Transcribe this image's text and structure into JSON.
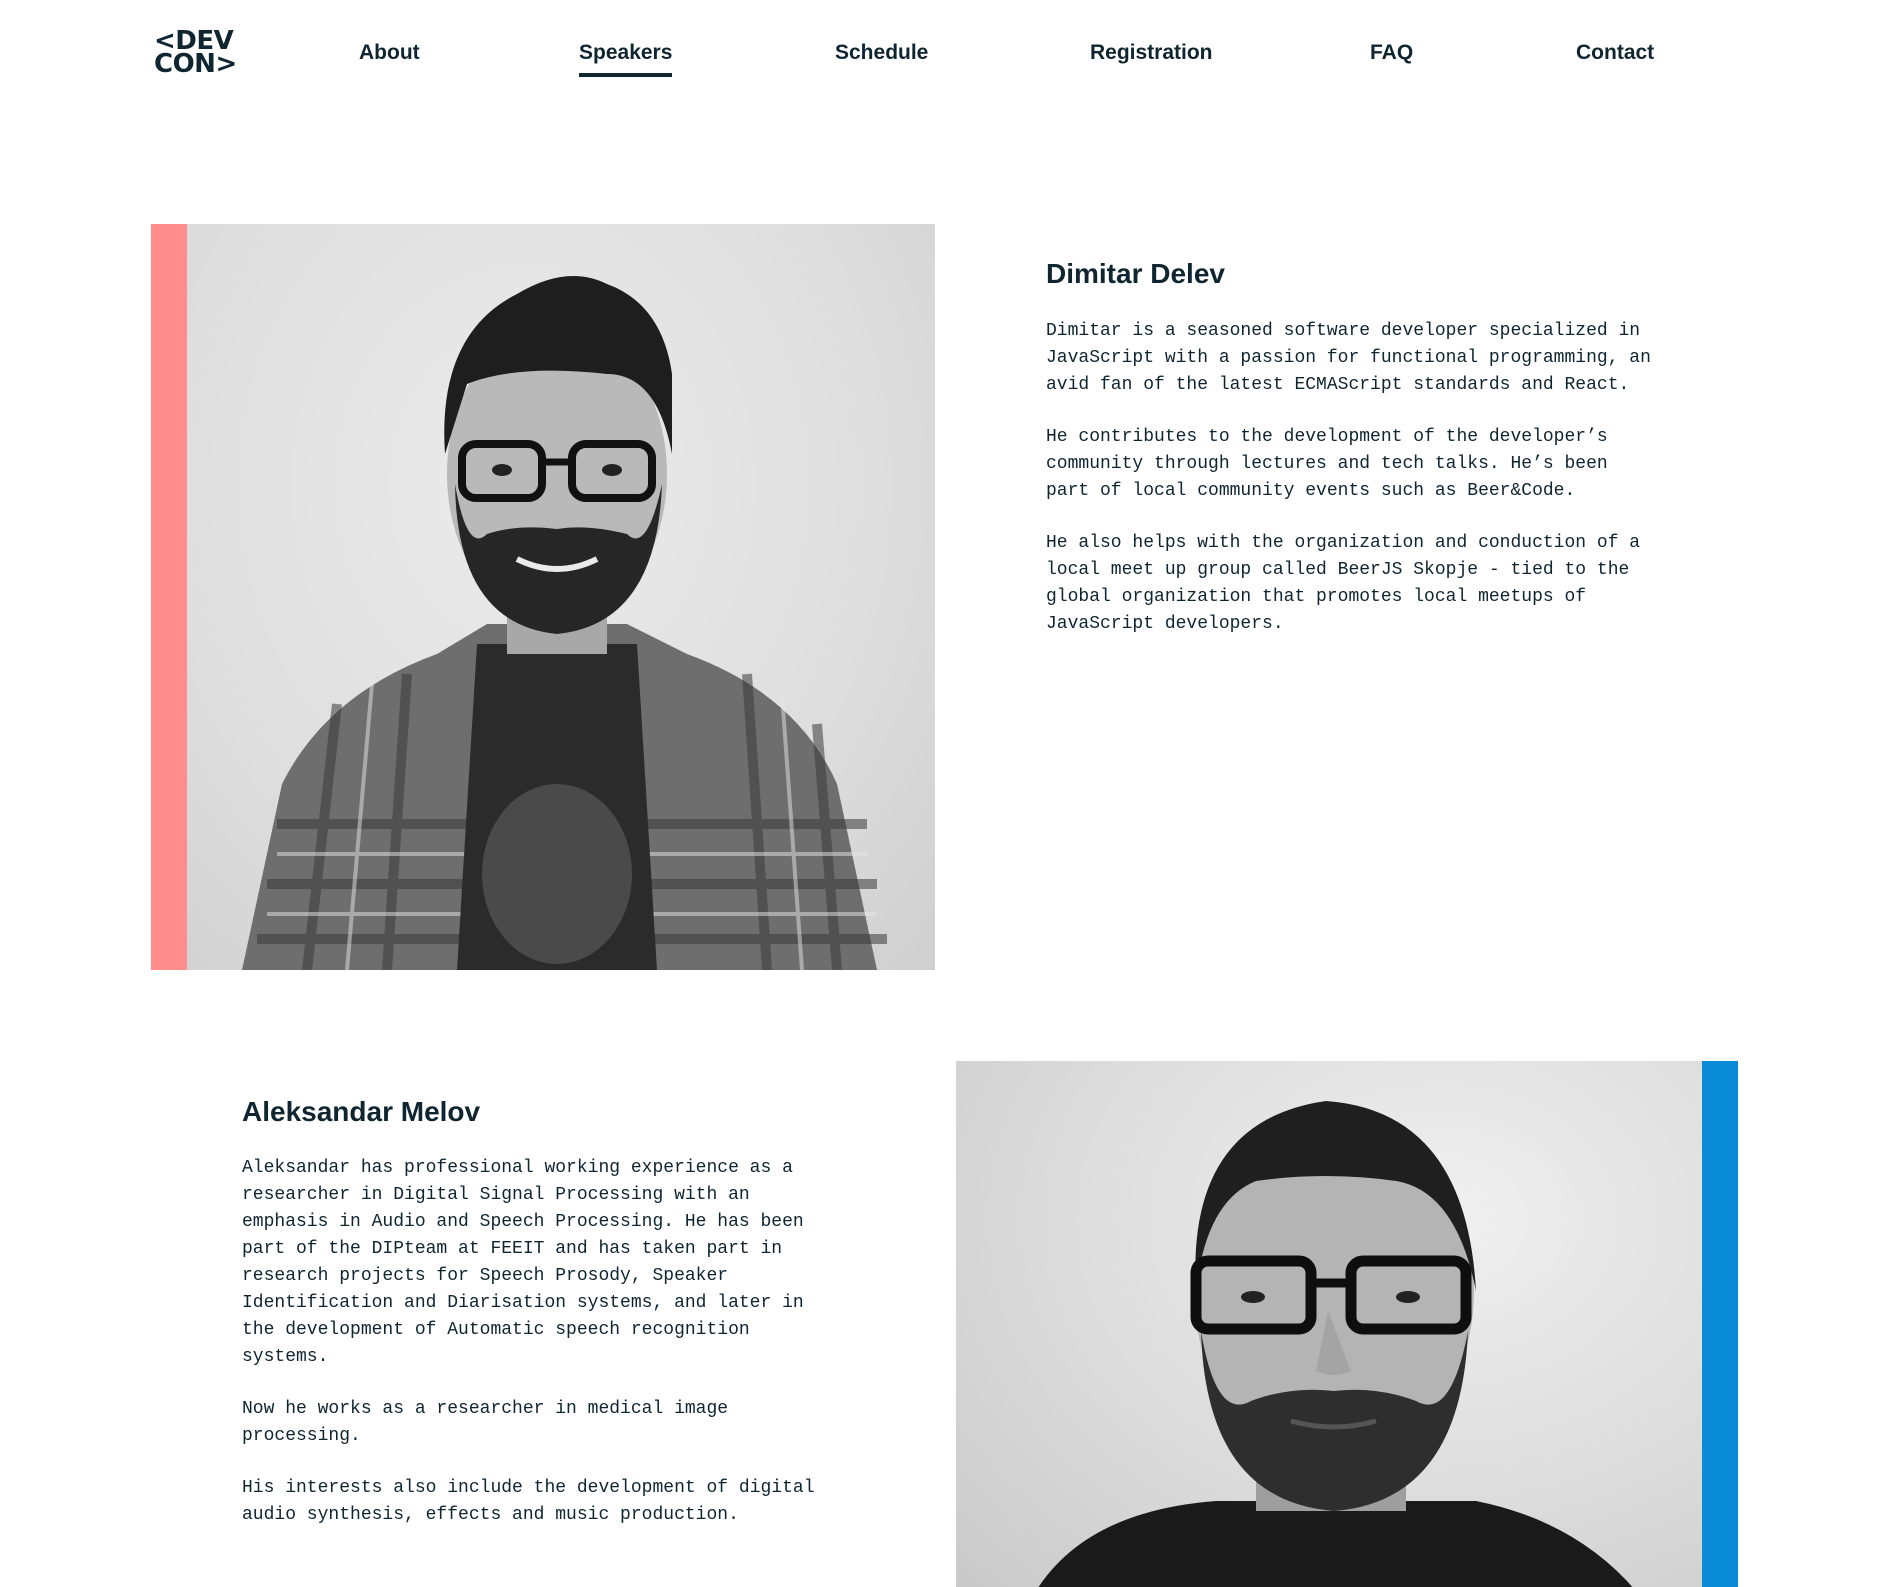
{
  "header": {
    "logo": {
      "line1": "<DEV",
      "line2": "CON>"
    },
    "nav": [
      {
        "label": "About",
        "active": false
      },
      {
        "label": "Speakers",
        "active": true
      },
      {
        "label": "Schedule",
        "active": false
      },
      {
        "label": "Registration",
        "active": false
      },
      {
        "label": "FAQ",
        "active": false
      },
      {
        "label": "Contact",
        "active": false
      }
    ]
  },
  "speakers": [
    {
      "name": "Dimitar Delev",
      "accent": "#ff8d8c",
      "bio": [
        "Dimitar is a seasoned software developer specialized in JavaScript with a passion for functional programming, an avid fan of the latest ECMAScript standards and React.",
        "He contributes to the development of the developer’s community through lectures and tech talks. He’s been part of local community events such as Beer&Code.",
        "He also helps with the organization and conduction of a local meet up group called BeerJS Skopje - tied to the global organization that promotes local meetups of JavaScript developers."
      ]
    },
    {
      "name": "Aleksandar Melov",
      "accent": "#0a8bd5",
      "bio": [
        "Aleksandar has professional working experience as a researcher in Digital Signal Processing with an emphasis in Audio and Speech Processing. He has been part of the DIPteam at FEEIT and has taken part in research projects for Speech Prosody, Speaker Identification and Diarisation systems, and later in the development of Automatic speech recognition systems.",
        "Now he works as a researcher in medical image processing.",
        "His interests also include the development of digital audio synthesis, effects and music production."
      ]
    }
  ]
}
